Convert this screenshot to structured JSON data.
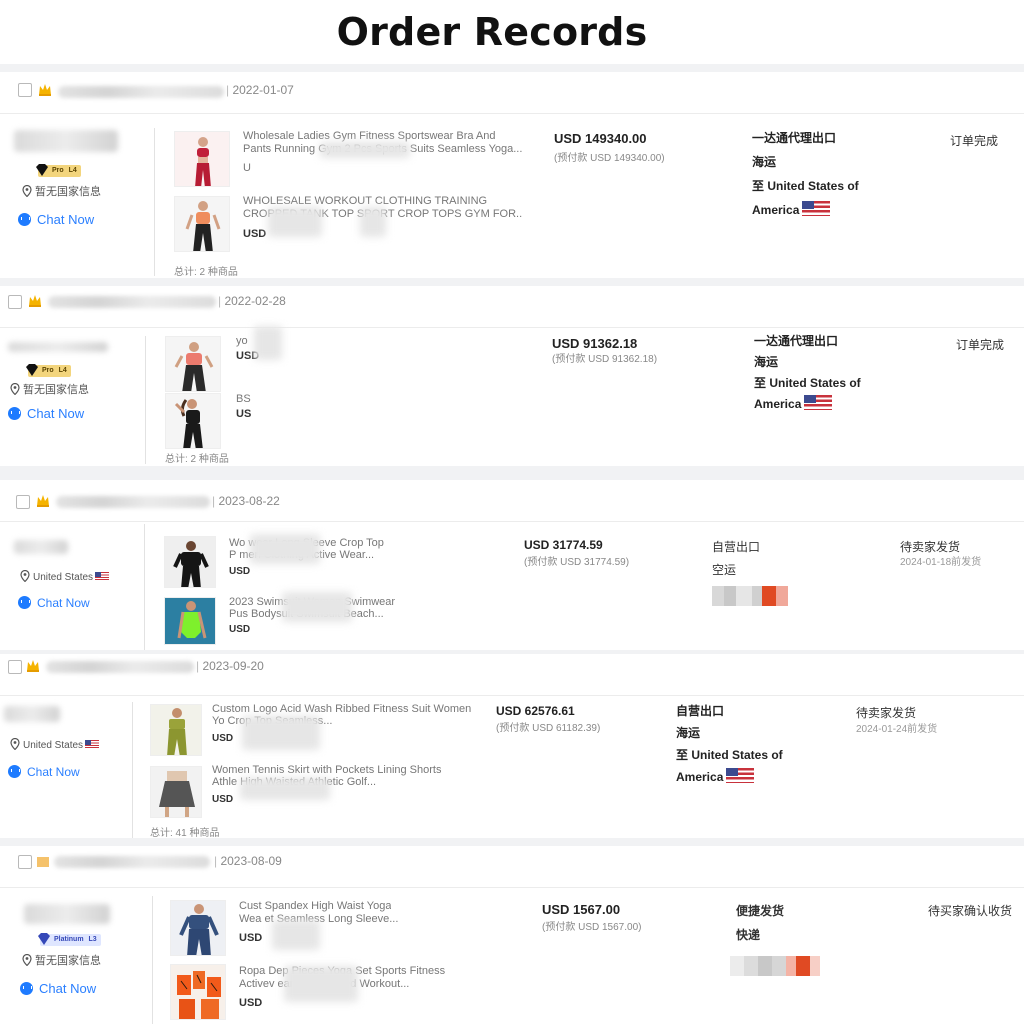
{
  "page": {
    "title": "Order Records"
  },
  "icons": {
    "checkbox": "checkbox-icon",
    "crown": "crown-icon",
    "location": "location-pin-icon",
    "chat": "chat-bubble-icon",
    "flag": "us-flag-icon",
    "gem": "diamond-icon"
  },
  "colors": {
    "accent": "#1e7bff",
    "crown": "#f5b300",
    "pixel_block": "#e04a23"
  },
  "orders": [
    {
      "date": "2022-01-07",
      "buyer": {
        "badge": "Pro",
        "badge_level": "L4",
        "location": "暂无国家信息",
        "chat": "Chat Now"
      },
      "products": [
        {
          "name_line1": "Wholesale Ladies Gym Fitness Sportswear Bra And",
          "name_line2": "Pants Running Gym 2 Pcs Sports Suits Seamless Yoga...",
          "line3": "U"
        },
        {
          "name_line1": "WHOLESALE WORKOUT CLOTHING TRAINING",
          "name_line2": "CROPPED TANK TOP SPORT CROP TOPS GYM FOR...",
          "price_label": "USD"
        }
      ],
      "total": "总计: 2 种商品",
      "amount": "USD 149340.00",
      "prepaid": "(预付款 USD 149340.00)",
      "ship_line1": "一达通代理出口",
      "ship_line2": "海运",
      "ship_line3": "至 United States of",
      "ship_line4": "America",
      "status": "订单完成"
    },
    {
      "date": "2022-02-28",
      "buyer": {
        "badge": "Pro",
        "badge_level": "L4",
        "location": "暂无国家信息",
        "chat": "Chat Now"
      },
      "products": [
        {
          "name_line1": "yo",
          "price_label": "USD"
        },
        {
          "name_line1": "BS",
          "price_label": "US"
        }
      ],
      "total": "总计: 2 种商品",
      "amount": "USD 91362.18",
      "prepaid": "(预付款 USD 91362.18)",
      "ship_line1": "一达通代理出口",
      "ship_line2": "海运",
      "ship_line3": "至 United States of",
      "ship_line4": "America",
      "status": "订单完成"
    },
    {
      "date": "2023-08-22",
      "buyer": {
        "location": "United States",
        "chat": "Chat Now"
      },
      "products": [
        {
          "name_line1": "Wo                      wear Long Sleeve Crop Top",
          "name_line2": "P                    men Clothing Active Wear...",
          "price_label": "USD"
        },
        {
          "name_line1": "2023                     Swimsuit Women Swimwear",
          "name_line2": "Pus                        Bodysuit Swimsuit Beach...",
          "price_label": "USD"
        }
      ],
      "amount": "USD 31774.59",
      "prepaid": "(预付款 USD 31774.59)",
      "ship_line1": "自营出口",
      "ship_line2": "空运",
      "status": "待卖家发货",
      "status_sub": "2024-01-18前发货"
    },
    {
      "date": "2023-09-20",
      "buyer": {
        "location": "United States",
        "chat": "Chat Now"
      },
      "products": [
        {
          "name_line1": "Custom Logo Acid Wash Ribbed Fitness Suit Women",
          "name_line2": "Yo                           Crop Top Seamless...",
          "price_label": "USD"
        },
        {
          "name_line1": "Women Tennis Skirt with Pockets Lining Shorts",
          "name_line2": "Athle                     High Waisted Athletic Golf...",
          "price_label": "USD"
        }
      ],
      "total": "总计: 41 种商品",
      "amount": "USD 62576.61",
      "prepaid": "(预付款 USD 61182.39)",
      "ship_line1": "自营出口",
      "ship_line2": "海运",
      "ship_line3": "至 United States of",
      "ship_line4": "America",
      "status": "待卖家发货",
      "status_sub": "2024-01-24前发货"
    },
    {
      "date": "2023-08-09",
      "buyer": {
        "badge": "Platinum",
        "badge_level": "L3",
        "location": "暂无国家信息",
        "chat": "Chat Now"
      },
      "products": [
        {
          "name_line1": "Cust                        Spandex High Waist Yoga",
          "name_line2": "Wea                        et Seamless Long Sleeve...",
          "price_label": "USD"
        },
        {
          "name_line1": "Ropa Dep                  Pieces Yoga Set Sports Fitness",
          "name_line2": "Activev                    eamless Ribbed Workout...",
          "price_label": "USD"
        }
      ],
      "amount": "USD 1567.00",
      "prepaid": "(预付款 USD 1567.00)",
      "ship_line1": "便捷发货",
      "ship_line2": "快递",
      "status": "待买家确认收货"
    }
  ]
}
